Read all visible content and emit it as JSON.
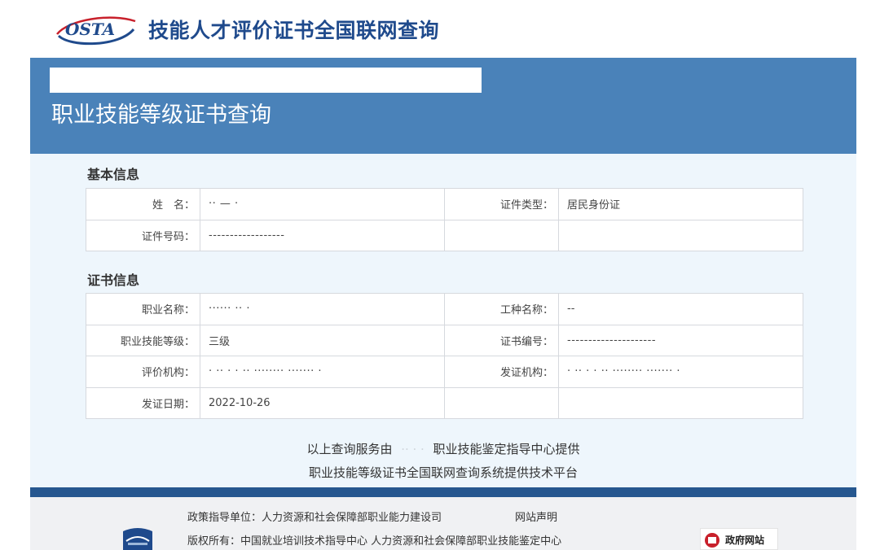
{
  "header": {
    "logo_text": "OSTA",
    "site_title": "技能人才评价证书全国联网查询"
  },
  "banner": {
    "title": "职业技能等级证书查询"
  },
  "basic_info": {
    "section_title": "基本信息",
    "rows": [
      {
        "label1": "姓　名：",
        "value1": "·· — ·",
        "label2": "证件类型：",
        "value2": "居民身份证"
      },
      {
        "label1": "证件号码：",
        "value1": "------------------",
        "label2": "",
        "value2": ""
      }
    ]
  },
  "cert_info": {
    "section_title": "证书信息",
    "rows": [
      {
        "label1": "职业名称：",
        "value1": "······ ·· ·",
        "label2": "工种名称：",
        "value2": "--"
      },
      {
        "label1": "职业技能等级：",
        "value1": "三级",
        "label2": "证书编号：",
        "value2": "---------------------"
      },
      {
        "label1": "评价机构：",
        "value1": "· ·· · · ·· ········ ······· ·",
        "label2": "发证机构：",
        "value2": "· ·· · · ·· ········ ······· ·"
      },
      {
        "label1": "发证日期：",
        "value1": "2022-10-26",
        "label2": "",
        "value2": ""
      }
    ]
  },
  "notes": {
    "line1_prefix": "以上查询服务由",
    "line1_masked": "·· · ·",
    "line1_suffix": "职业技能鉴定指导中心提供",
    "line2": "职业技能等级证书全国联网查询系统提供技术平台"
  },
  "footer": {
    "policy": "政策指导单位：人力资源和社会保障部职业能力建设司",
    "statement_link": "网站声明",
    "copyright": "版权所有：中国就业培训技术指导中心 人力资源和社会保障部职业技能鉴定中心",
    "gov_badge": "政府网站"
  },
  "colors": {
    "banner": "#4a82b9",
    "divider": "#26578f",
    "title": "#1f4a8c",
    "logo_red": "#c8202b"
  }
}
